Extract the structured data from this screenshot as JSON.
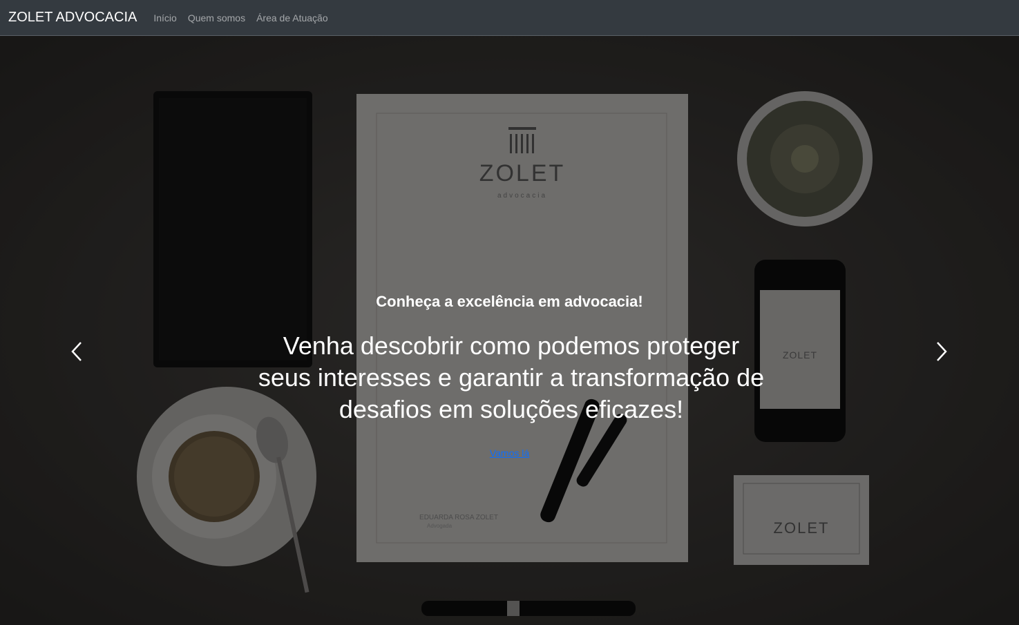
{
  "navbar": {
    "brand": "ZOLET ADVOCACIA",
    "links": [
      "Início",
      "Quem somos",
      "Área de Atuação"
    ]
  },
  "hero": {
    "subtitle": "Conheça a excelência em advocacia!",
    "headline": "Venha descobrir como podemos proteger seus interesses e garantir a transformação de desafios em soluções eficazes!",
    "cta": "Vamos lá",
    "controls": {
      "prev_icon": "chevron-left-icon",
      "next_icon": "chevron-right-icon"
    },
    "background_props": {
      "letterhead_logo": "ZOLET",
      "letterhead_sub": "advocacia",
      "letterhead_name": "EDUARDA ROSA ZOLET",
      "letterhead_role": "Advogada",
      "phone_logo": "ZOLET",
      "card_logo": "ZOLET"
    }
  },
  "colors": {
    "navbar_bg": "#343a40",
    "link_accent": "#0d6efd",
    "text": "#ffffff"
  }
}
